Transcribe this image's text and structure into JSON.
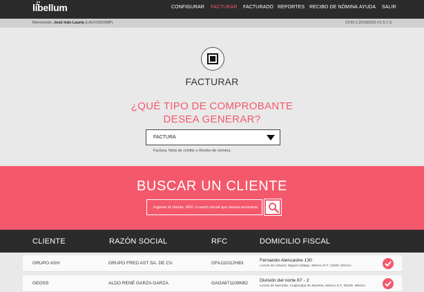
{
  "brand": {
    "name": "libellum"
  },
  "nav": {
    "items": [
      {
        "label": "CONFIGURAR",
        "active": false
      },
      {
        "label": "FACTURAR",
        "active": true
      },
      {
        "label": "FACTURADO",
        "active": false
      },
      {
        "label": "REPORTES",
        "active": false
      },
      {
        "label": "RECIBO DE NÓMINA",
        "active": false
      },
      {
        "label": "AYUDA",
        "active": false
      },
      {
        "label": "SALIR",
        "active": false
      }
    ]
  },
  "infobar": {
    "welcome_prefix": "Bienvenido:",
    "user_name": "José Iván Lauria",
    "rfc": "(LAIXX0523MP)",
    "version": "CFDI 2.20150223-V1.5.7.3"
  },
  "facturar": {
    "icon": "invoice-square-icon",
    "title": "FACTURAR",
    "question_line1": "¿QUÉ TIPO DE COMPROBANTE",
    "question_line2": "DESEA GENERAR?",
    "select_value": "FACTURA",
    "select_hint": "Factura, Nota de crédito o Recibo de nómina."
  },
  "buscar": {
    "title": "BUSCAR UN CLIENTE",
    "placeholder": "Ingrese el cliente, RFC o razón social que desea encontrar.",
    "button_icon": "search-icon"
  },
  "table": {
    "headers": {
      "cliente": "CLIENTE",
      "razon": "RAZÓN SOCIAL",
      "rfc": "RFC",
      "domicilio": "DOMICILIO FISCAL"
    },
    "rows": [
      {
        "cliente": "GRUPO ASH",
        "razon": "GRUPO FRED AST SA. DE CV.",
        "rfc": "GFA111012H83",
        "domicilio": "Fernando Alencastre 130",
        "domicilio_detalle": "Lomas de Vireyes, Miguel Hidalgo, México D.F. 11000, México"
      },
      {
        "cliente": "GEOSS",
        "razon": "ALDO RENÉ GARZA GARZA",
        "rfc": "GAGA671109KB2",
        "domicilio": "División del norte 87 - 2",
        "domicilio_detalle": "Lomas de Memetla, Cuajimalpa de Morelos, México D.F. 05330, México"
      }
    ]
  },
  "colors": {
    "accent": "#f4586c",
    "dark": "#2b2b2b",
    "background": "#e9e9e9"
  }
}
